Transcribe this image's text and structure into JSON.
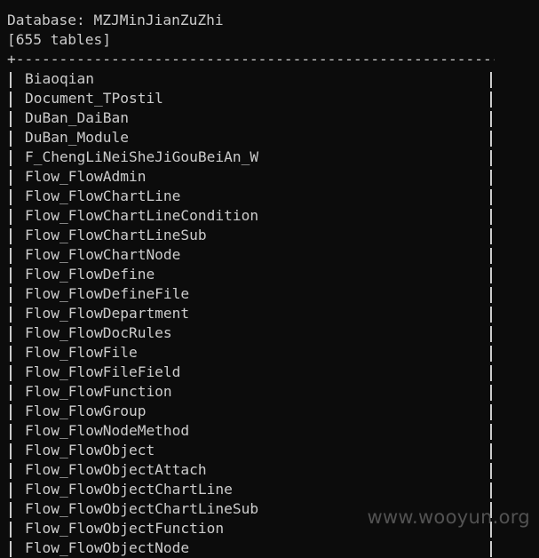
{
  "header": {
    "prev_line": "                                       ",
    "database_line": "Database: MZJMinJianZuZhi",
    "count_line": "[655 tables]",
    "border": "+---------------------------------------------------------+"
  },
  "tables": [
    "Biaoqian",
    "Document_TPostil",
    "DuBan_DaiBan",
    "DuBan_Module",
    "F_ChengLiNeiSheJiGouBeiAn_W",
    "Flow_FlowAdmin",
    "Flow_FlowChartLine",
    "Flow_FlowChartLineCondition",
    "Flow_FlowChartLineSub",
    "Flow_FlowChartNode",
    "Flow_FlowDefine",
    "Flow_FlowDefineFile",
    "Flow_FlowDepartment",
    "Flow_FlowDocRules",
    "Flow_FlowFile",
    "Flow_FlowFileField",
    "Flow_FlowFunction",
    "Flow_FlowGroup",
    "Flow_FlowNodeMethod",
    "Flow_FlowObject",
    "Flow_FlowObjectAttach",
    "Flow_FlowObjectChartLine",
    "Flow_FlowObjectChartLineSub",
    "Flow_FlowObjectFunction",
    "Flow_FlowObjectNode"
  ],
  "watermark": "www.wooyun.org"
}
